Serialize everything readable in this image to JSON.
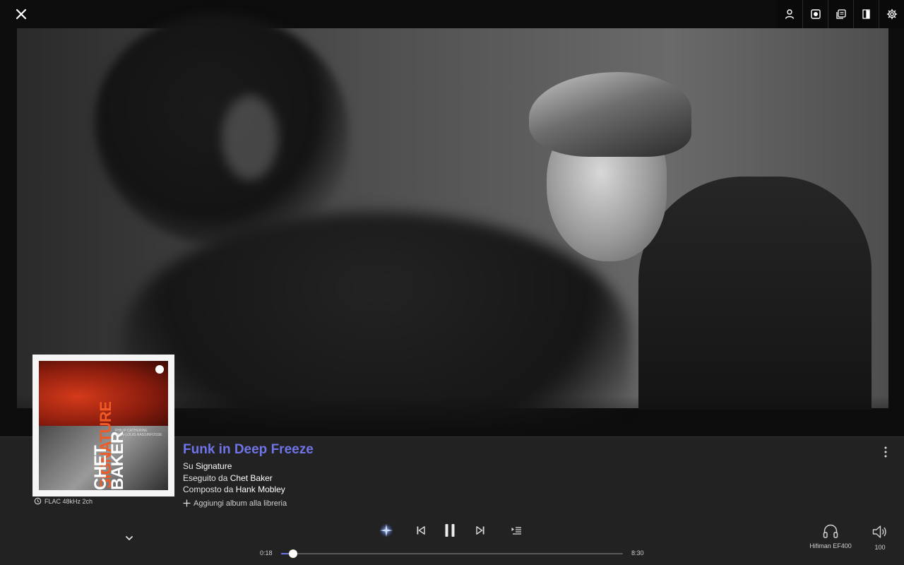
{
  "colors": {
    "accent": "#6f74e8",
    "panel_bg": "#222222",
    "top_bar_bg": "#0a0a0a"
  },
  "top_bar": {
    "close_icon": "close-icon",
    "actions": [
      {
        "name": "profile-button",
        "icon": "user-icon"
      },
      {
        "name": "focus-button",
        "icon": "focus-icon"
      },
      {
        "name": "lyrics-button",
        "icon": "lyrics-icon"
      },
      {
        "name": "booklet-button",
        "icon": "booklet-icon"
      },
      {
        "name": "settings-button",
        "icon": "gear-icon"
      }
    ]
  },
  "album_cover": {
    "title_text": "SIGNATURE",
    "artist_text": "CHET BAKER",
    "credit_text": "PHILIP CATHERINE\nJEAN-LOUIS RASSINFOSSE"
  },
  "track": {
    "title": "Funk in Deep Freeze",
    "album_prefix": "Su",
    "album": "Signature",
    "performer_prefix": "Eseguito da",
    "performer": "Chet Baker",
    "composer_prefix": "Composto da",
    "composer": "Hank Mobley",
    "add_to_library": "Aggiungi album alla libreria",
    "format": "FLAC 48kHz 2ch"
  },
  "playback": {
    "elapsed": "0:18",
    "duration": "8:30",
    "progress_fraction": 0.0353,
    "state": "playing"
  },
  "output": {
    "device": "Hifiman EF400",
    "volume": "100"
  }
}
